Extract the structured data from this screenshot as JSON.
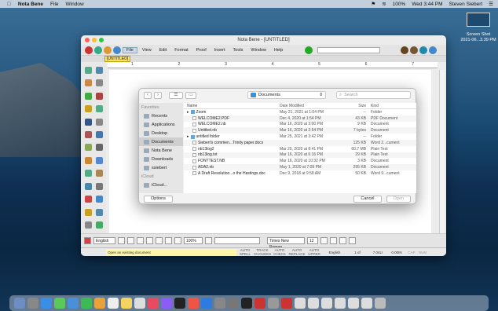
{
  "menubar": {
    "app": "Nota Bene",
    "items": [
      "File",
      "Window"
    ],
    "battery": "100%",
    "clock": "Wed 3:44 PM",
    "user": "Steven Siebert"
  },
  "screenshot_thumb": {
    "label_line1": "Screen Shot",
    "label_line2": "2021-06...3.39 PM"
  },
  "window": {
    "title": "Nota Bene - [UNTITLED]",
    "doc_tab": "[UNTITLED]"
  },
  "menus": [
    "File",
    "View",
    "Edit",
    "Format",
    "Proof",
    "Insert",
    "Tools",
    "Window",
    "Help"
  ],
  "ruler": [
    "1",
    "2",
    "3",
    "4",
    "5",
    "6",
    "7"
  ],
  "dialog": {
    "location": "Documents",
    "search_placeholder": "Search",
    "sidebar_favorites_header": "Favorites",
    "sidebar_favorites": [
      "Recents",
      "Applications",
      "Desktop",
      "Documents",
      "Nota Bene",
      "Downloads",
      "ssiebert"
    ],
    "sidebar_icloud_header": "iCloud",
    "sidebar_icloud": [
      "iCloud..."
    ],
    "columns": {
      "name": "Name",
      "date": "Date Modified",
      "size": "Size",
      "kind": "Kind"
    },
    "files": [
      {
        "name": "Zoom",
        "date": "May 21, 2021 at 1:04 PM",
        "size": "--",
        "kind": "Folder",
        "folder": true
      },
      {
        "name": "WELCOME2.PDF",
        "date": "Dec 4, 2020 at 1:54 PM",
        "size": "43 KB",
        "kind": "PDF Document",
        "folder": false
      },
      {
        "name": "WELCOME2.nb",
        "date": "Mar 16, 2020 at 3:00 PM",
        "size": "9 KB",
        "kind": "Document",
        "folder": false
      },
      {
        "name": "Untitled.nb",
        "date": "Mar 16, 2020 at 2:54 PM",
        "size": "7 bytes",
        "kind": "Document",
        "folder": false
      },
      {
        "name": "untitled folder",
        "date": "Mar 25, 2021 at 3:42 PM",
        "size": "--",
        "kind": "Folder",
        "folder": true
      },
      {
        "name": "Siebert's commen...Trinity paper.docx",
        "date": "",
        "size": "125 KB",
        "kind": "Word 2...cument",
        "folder": false
      },
      {
        "name": "nb13log2",
        "date": "Mar 20, 2020 at 8:41 PM",
        "size": "60.7 MB",
        "kind": "Plain Text",
        "folder": false
      },
      {
        "name": "nb13log.txt",
        "date": "Mar 16, 2020 at 6:16 PM",
        "size": "29 KB",
        "kind": "Plain Text",
        "folder": false
      },
      {
        "name": "FONTTEST.NB",
        "date": "Mar 16, 2020 at 10:32 PM",
        "size": "3 KB",
        "kind": "Document",
        "folder": false
      },
      {
        "name": "ADA2.nb",
        "date": "May 1, 2020 at 7:09 PM",
        "size": "295 KB",
        "kind": "Document",
        "folder": false
      },
      {
        "name": "A Draft Resolution...o the Hastings.doc",
        "date": "Dec 9, 2018 at 9:58 AM",
        "size": "50 KB",
        "kind": "Word 9...cument",
        "folder": false
      }
    ],
    "options_label": "Options",
    "cancel_label": "Cancel",
    "open_label": "Open"
  },
  "bottombar": {
    "language": "English",
    "zoom": "100%",
    "font": "Times New Roman",
    "font_size": "12"
  },
  "status": {
    "message": "Open an existing document",
    "flags": [
      "AUTO SPELL",
      "TRACK CHANGES",
      "AUTO CHECK",
      "AUTO REPLACE",
      "AUTO UPPER"
    ],
    "language": "English",
    "page": "1 of",
    "position": "7.04LI",
    "zoom_pct": "0.00IN",
    "cap": "CAP",
    "num": "NUM"
  }
}
